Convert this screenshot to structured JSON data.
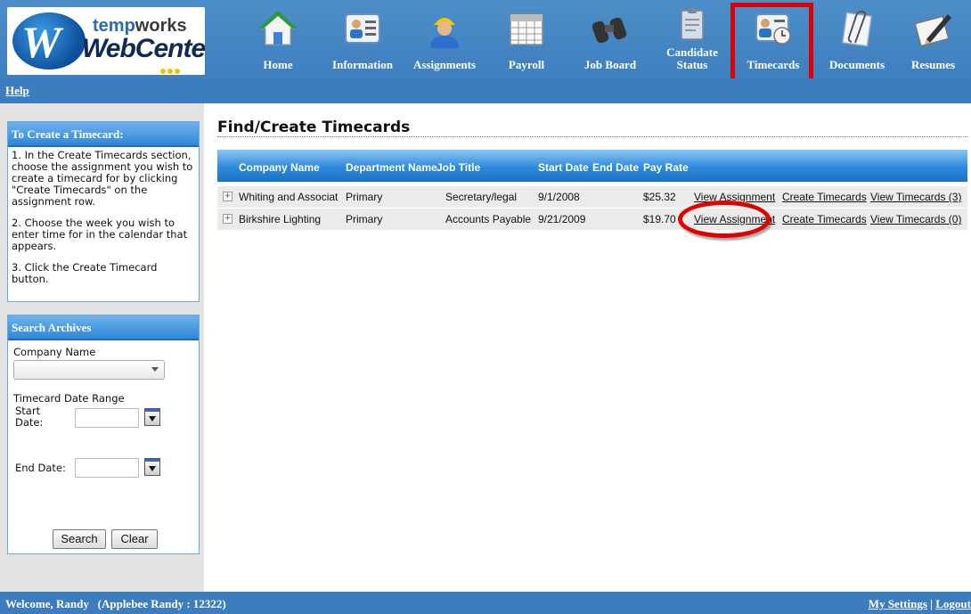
{
  "logo": {
    "brand_prefix": "temp",
    "brand_suffix": "works",
    "product": "WebCenter",
    "letter": "W"
  },
  "nav": [
    {
      "label": "Home",
      "icon": "house-icon"
    },
    {
      "label": "Information",
      "icon": "id-card-icon"
    },
    {
      "label": "Assignments",
      "icon": "worker-icon"
    },
    {
      "label": "Payroll",
      "icon": "calendar-icon"
    },
    {
      "label": "Job Board",
      "icon": "binoculars-icon"
    },
    {
      "label": "Candidate Status",
      "icon": "clipboard-icon"
    },
    {
      "label": "Timecards",
      "icon": "timecard-icon",
      "selected": true
    },
    {
      "label": "Documents",
      "icon": "paperclip-icon"
    },
    {
      "label": "Resumes",
      "icon": "notepad-pen-icon"
    }
  ],
  "helpbar": {
    "help_label": "Help"
  },
  "sidebar": {
    "instructions": {
      "title": "To Create a Timecard:",
      "steps": [
        "1. In the Create Timecards section, choose the assignment you wish to create a timecard for by clicking \"Create Timecards\" on the assignment row.",
        "2. Choose the week you wish to enter time for in the calendar that appears.",
        "3. Click the Create Timecard button."
      ]
    },
    "search": {
      "title": "Search Archives",
      "company_label": "Company Name",
      "company_value": "",
      "date_range_label": "Timecard Date Range",
      "start_label": "Start Date:",
      "end_label": "End Date:",
      "start_value": "",
      "end_value": "",
      "search_button": "Search",
      "clear_button": "Clear"
    }
  },
  "main": {
    "title": "Find/Create Timecards",
    "columns": [
      "Company Name",
      "Department Name",
      "Job Title",
      "Start Date",
      "End Date",
      "Pay Rate"
    ],
    "rows": [
      {
        "company": "Whiting and Associat",
        "department": "Primary",
        "job_title": "Secretary/legal",
        "start_date": "9/1/2008",
        "end_date": "",
        "pay_rate": "$25.32",
        "view_assignment": "View Assignment",
        "create_timecards": "Create Timecards",
        "view_timecards": "View Timecards (3)"
      },
      {
        "company": "Birkshire Lighting",
        "department": "Primary",
        "job_title": "Accounts Payable",
        "start_date": "9/21/2009",
        "end_date": "",
        "pay_rate": "$19.70",
        "view_assignment": "View Assignment",
        "create_timecards": "Create Timecards",
        "view_timecards": "View Timecards (0)"
      }
    ]
  },
  "footer": {
    "welcome": "Welcome, Randy",
    "user_info": "(Applebee Randy : 12322)",
    "settings_link": "My Settings",
    "separator": "|",
    "logout_link": "Logout"
  },
  "colors": {
    "header_blue": "#3d7dbd",
    "highlight_red": "#e00000",
    "grid_header_blue": "#2e89dc"
  }
}
